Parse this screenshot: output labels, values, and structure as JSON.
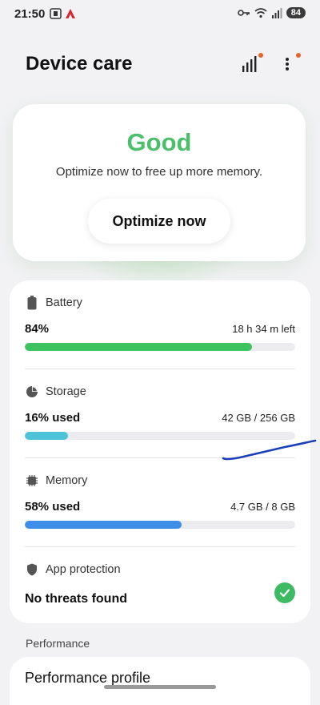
{
  "status_bar": {
    "time": "21:50",
    "battery": "84"
  },
  "header": {
    "title": "Device care"
  },
  "status_card": {
    "status_word": "Good",
    "message": "Optimize now to free up more memory.",
    "optimize_label": "Optimize now"
  },
  "battery": {
    "label": "Battery",
    "value": "84%",
    "detail": "18 h 34 m left",
    "fill_percent": 84,
    "color": "#3cc35f"
  },
  "storage": {
    "label": "Storage",
    "value": "16% used",
    "detail": "42 GB / 256 GB",
    "fill_percent": 16,
    "color": "#4cc3d6"
  },
  "memory": {
    "label": "Memory",
    "value": "58% used",
    "detail": "4.7 GB / 8 GB",
    "fill_percent": 58,
    "color": "#3d8ee8"
  },
  "app_protection": {
    "label": "App protection",
    "value": "No threats found"
  },
  "performance": {
    "header": "Performance",
    "item_label": "Performance profile"
  },
  "colors": {
    "good_green": "#4cbf6a",
    "badge_orange": "#e8632a",
    "annotation_blue": "#1a3fb8"
  }
}
